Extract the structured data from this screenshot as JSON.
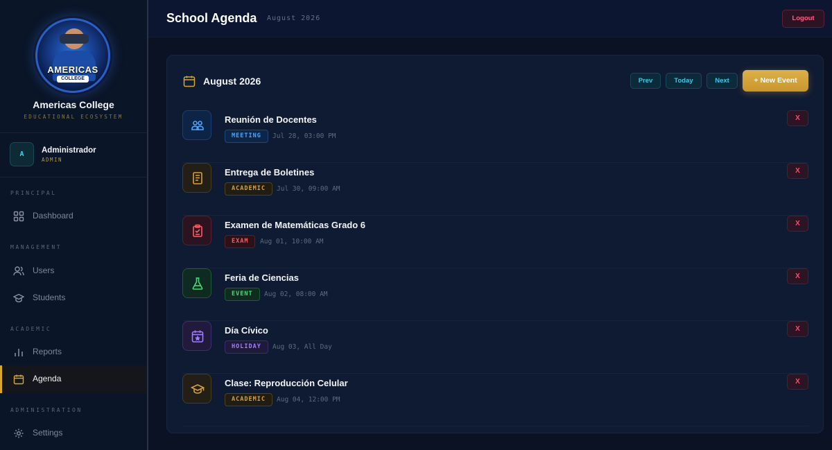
{
  "sidebar": {
    "logo": {
      "text": "AMERICAS",
      "sub": "COLLEGE"
    },
    "brand_name": "Americas College",
    "brand_tagline": "EDUCATIONAL ECOSYSTEM",
    "user": {
      "initial": "A",
      "name": "Administrador",
      "role": "ADMIN"
    },
    "sections": {
      "principal": "PRINCIPAL",
      "management": "MANAGEMENT",
      "academic": "ACADEMIC",
      "administration": "ADMINISTRATION"
    },
    "items": {
      "dashboard": "Dashboard",
      "users": "Users",
      "students": "Students",
      "reports": "Reports",
      "agenda": "Agenda",
      "settings": "Settings"
    },
    "active_item": "Agenda",
    "accent_color": "#d8a730"
  },
  "header": {
    "title": "School Agenda",
    "subtitle": "August 2026",
    "logout_label": "Logout"
  },
  "calendar": {
    "month_title": "August 2026",
    "prev_label": "Prev",
    "today_label": "Today",
    "next_label": "Next",
    "new_event_label": "+ New Event",
    "delete_label": "X",
    "events": [
      {
        "title": "Reunión de Docentes",
        "type": "MEETING",
        "time": "Jul 28, 03:00 PM",
        "icon": "users-icon",
        "color": "#4aa6ff"
      },
      {
        "title": "Entrega de Boletines",
        "type": "ACADEMIC",
        "time": "Jul 30, 09:00 AM",
        "icon": "document-icon",
        "color": "#d9a13a"
      },
      {
        "title": "Examen de Matemáticas Grado 6",
        "type": "EXAM",
        "time": "Aug 01, 10:00 AM",
        "icon": "clipboard-icon",
        "color": "#ff5a62"
      },
      {
        "title": "Feria de Ciencias",
        "type": "EVENT",
        "time": "Aug 02, 08:00 AM",
        "icon": "flask-icon",
        "color": "#3fdc7c"
      },
      {
        "title": "Día Cívico",
        "type": "HOLIDAY",
        "time": "Aug 03, All Day",
        "icon": "calendar-star-icon",
        "color": "#a27cff"
      },
      {
        "title": "Clase: Reproducción Celular",
        "type": "ACADEMIC",
        "time": "Aug 04, 12:00 PM",
        "icon": "graduation-cap-icon",
        "color": "#d9a13a"
      }
    ]
  }
}
